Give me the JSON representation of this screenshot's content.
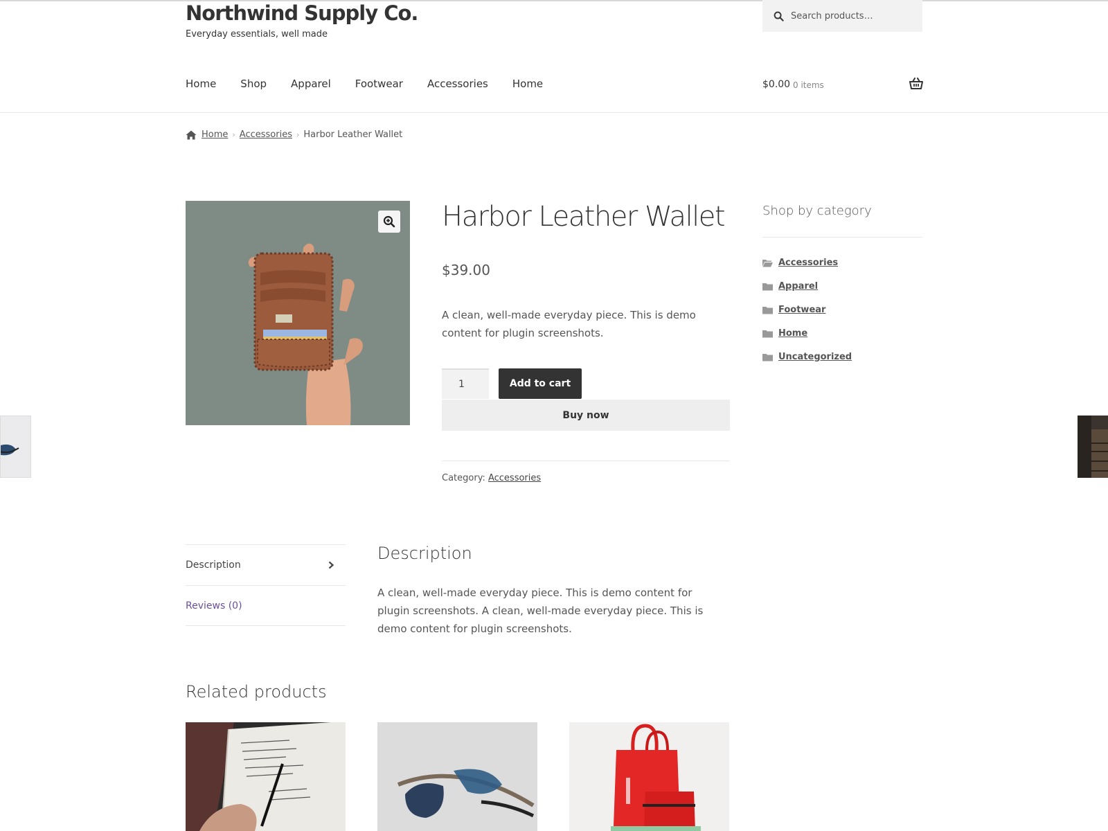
{
  "site": {
    "title": "Northwind Supply Co.",
    "tagline": "Everyday essentials, well made"
  },
  "search": {
    "placeholder": "Search products…"
  },
  "nav": {
    "items": [
      "Home",
      "Shop",
      "Apparel",
      "Footwear",
      "Accessories",
      "Home"
    ]
  },
  "cart": {
    "total": "$0.00",
    "count": "0 items"
  },
  "breadcrumb": {
    "home": "Home",
    "category": "Accessories",
    "current": "Harbor Leather Wallet"
  },
  "product": {
    "title": "Harbor Leather Wallet",
    "price": "$39.00",
    "short_description": "A clean, well-made everyday piece. This is demo content for plugin screenshots.",
    "quantity": "1",
    "add_to_cart_label": "Add to cart",
    "buy_now_label": "Buy now",
    "category_label": "Category:",
    "category": "Accessories"
  },
  "sidebar": {
    "title": "Shop by category",
    "categories": [
      "Accessories",
      "Apparel",
      "Footwear",
      "Home",
      "Uncategorized"
    ]
  },
  "tabs": {
    "items": [
      "Description",
      "Reviews (0)"
    ]
  },
  "description": {
    "heading": "Description",
    "body": "A clean, well-made everyday piece. This is demo content for plugin screenshots. A clean, well-made everyday piece. This is demo content for plugin screenshots."
  },
  "related": {
    "heading": "Related products"
  },
  "colors": {
    "accent_dark": "#333333",
    "tab_link": "#6a4fa0",
    "product_bg": "#7f8c86"
  },
  "icons": {
    "search": "search-icon",
    "cart": "basket-icon",
    "breadcrumb_home": "home-icon",
    "zoom": "zoom-in-icon",
    "category": "folder-icon",
    "tab_arrow": "chevron-right-icon"
  }
}
